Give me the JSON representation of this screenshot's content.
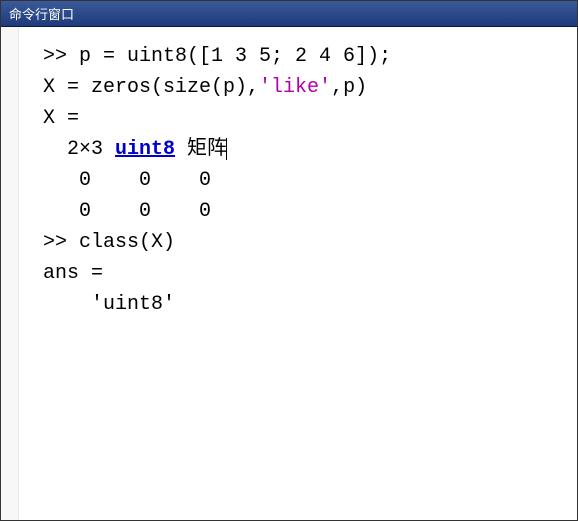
{
  "window": {
    "title": "命令行窗口"
  },
  "code": {
    "prompt1": ">> ",
    "line1a": "p = uint8([1 3 5; 2 4 6]);",
    "line2a": "X = zeros(size(p),",
    "line2_str": "'like'",
    "line2b": ",p)",
    "blank": "",
    "out_var1": "X =",
    "out_size_pre": "  2×3 ",
    "out_type_link": "uint8",
    "out_size_post": " 矩阵",
    "matrix_row1": "   0    0    0",
    "matrix_row2": "   0    0    0",
    "prompt2": ">> ",
    "line3": "class(X)",
    "out_var2": "ans =",
    "out_val2": "    'uint8'"
  }
}
